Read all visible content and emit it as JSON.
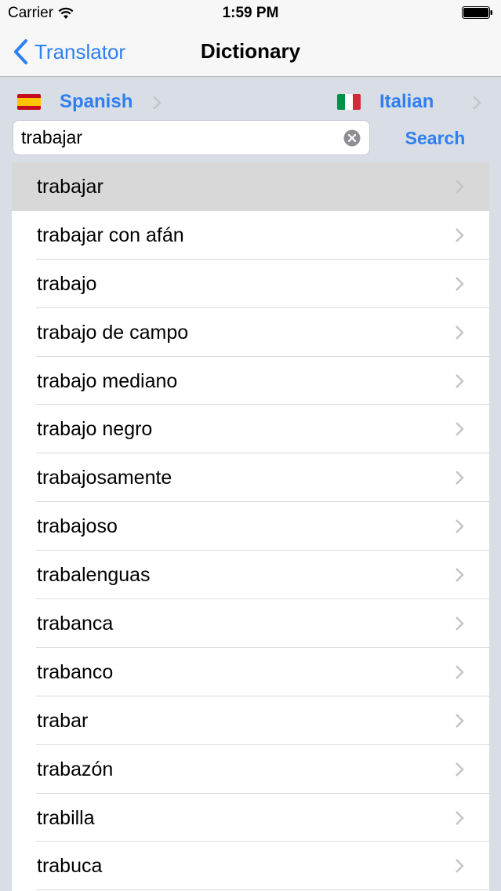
{
  "status_bar": {
    "carrier": "Carrier",
    "time": "1:59 PM"
  },
  "nav": {
    "back_label": "Translator",
    "title": "Dictionary"
  },
  "languages": {
    "source": {
      "label": "Spanish",
      "flag": "spain-flag"
    },
    "target": {
      "label": "Italian",
      "flag": "italy-flag"
    }
  },
  "search": {
    "value": "trabajar",
    "button_label": "Search"
  },
  "results": [
    {
      "label": "trabajar",
      "selected": true
    },
    {
      "label": "trabajar con afán"
    },
    {
      "label": "trabajo"
    },
    {
      "label": "trabajo de campo"
    },
    {
      "label": "trabajo mediano"
    },
    {
      "label": "trabajo negro"
    },
    {
      "label": "trabajosamente"
    },
    {
      "label": "trabajoso"
    },
    {
      "label": "trabalenguas"
    },
    {
      "label": "trabanca"
    },
    {
      "label": "trabanco"
    },
    {
      "label": "trabar"
    },
    {
      "label": "trabazón"
    },
    {
      "label": "trabilla"
    },
    {
      "label": "trabuca"
    }
  ],
  "colors": {
    "accent": "#2f7ff0",
    "background": "#d8dde6",
    "selected_row": "#d8d8d8"
  }
}
